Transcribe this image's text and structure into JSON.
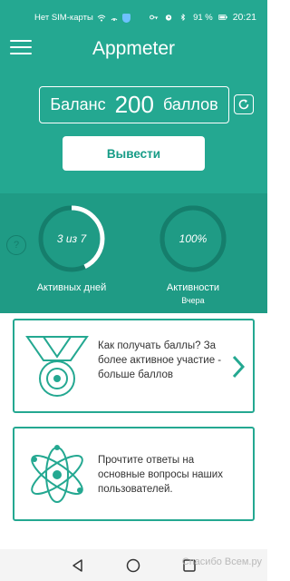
{
  "status_bar": {
    "carrier": "Нет SIM-карты",
    "battery": "91 %",
    "time": "20:21",
    "icons": [
      "wifi-icon",
      "hotspot-icon",
      "shield-icon",
      "key-icon",
      "alarm-icon",
      "bluetooth-icon",
      "battery-icon"
    ]
  },
  "header": {
    "title": "Appmeter",
    "menu_icon": "hamburger-icon"
  },
  "balance": {
    "label": "Баланс",
    "value": "200",
    "unit": "баллов",
    "refresh_icon": "refresh-icon"
  },
  "withdraw": {
    "label": "Вывести"
  },
  "stats": {
    "help_symbol": "?",
    "active_days": {
      "value_text": "3 из 7",
      "progress": 0.4286,
      "label": "Активных дней"
    },
    "activity": {
      "value_text": "100%",
      "progress": 1.0,
      "label": "Активности",
      "sublabel": "Вчера"
    }
  },
  "cards": [
    {
      "text": "Как получать баллы? За более активное участие - больше баллов",
      "icon": "medal-icon",
      "chevron_icon": "chevron-right-icon"
    },
    {
      "text": "Прочтите ответы на основные вопросы наших пользователей.",
      "icon": "atom-icon"
    }
  ],
  "navbar": {
    "buttons": [
      "back-icon",
      "home-icon",
      "recent-apps-icon"
    ]
  },
  "watermark": "Спасибо Всем.ру",
  "colors": {
    "primary": "#24a891",
    "stats_bg": "#1f9b85",
    "ring_track": "#157e6c",
    "ring_fill": "#ffffff",
    "card_border": "#24a891",
    "button_text": "#179c87"
  }
}
